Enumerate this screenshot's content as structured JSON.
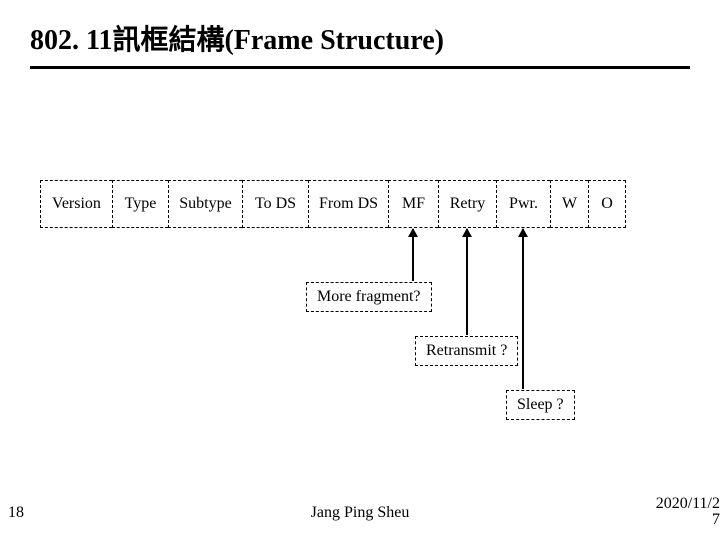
{
  "title": "802. 11訊框結構(Frame Structure)",
  "fields": {
    "version": "Version",
    "type": "Type",
    "subtype": "Subtype",
    "tods": "To DS",
    "fromds": "From DS",
    "mf": "MF",
    "retry": "Retry",
    "pwr": "Pwr.",
    "w": "W",
    "o": "O"
  },
  "annotations": {
    "mf": "More fragment?",
    "retry": "Retransmit ?",
    "pwr": "Sleep ?"
  },
  "footer": {
    "page": "18",
    "author": "Jang Ping Sheu",
    "date": "2020/11/2",
    "date2": "7"
  }
}
